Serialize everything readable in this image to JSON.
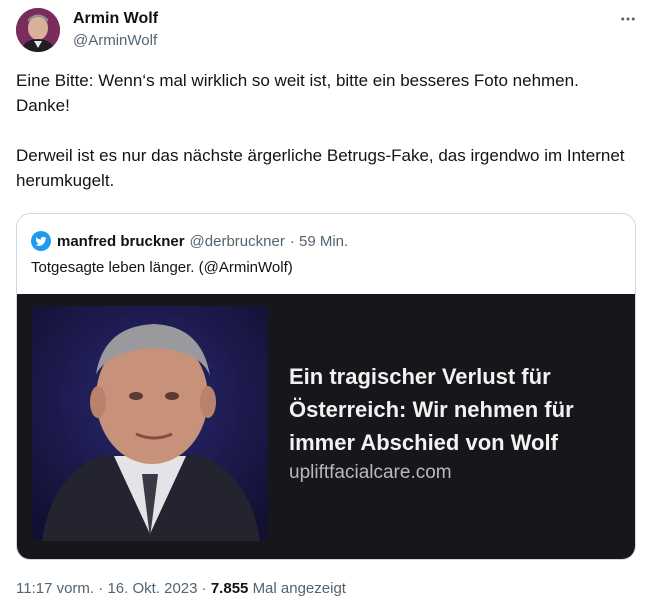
{
  "author": {
    "name": "Armin Wolf",
    "handle": "@ArminWolf",
    "avatar_icon": "profile-photo"
  },
  "more_icon": "more-horizontal-icon",
  "tweet": {
    "paragraph_1": "Eine Bitte: Wenn‘s mal wirklich so weit ist, bitte ein besseres Foto nehmen. Danke!",
    "paragraph_2": "Derweil ist es nur das nächste ärgerliche Betrugs-Fake, das irgendwo im Internet herumkugelt."
  },
  "quoted": {
    "icon": "twitter-bird-icon",
    "name": "manfred bruckner",
    "handle": "@derbruckner",
    "time": "· 59 Min.",
    "text": "Totgesagte leben länger. (@ArminWolf)",
    "card": {
      "title": "Ein tragischer Verlust für Österreich: Wir nehmen für immer Abschied von Wolf",
      "domain": "upliftfacialcare.com"
    }
  },
  "meta": {
    "time": "11:17 vorm.",
    "date": "16. Okt. 2023",
    "separator": "·",
    "views": "7.855",
    "views_label": "Mal angezeigt"
  },
  "colors": {
    "text": "#0f1419",
    "secondary": "#536471",
    "border": "#cfd9de",
    "twitter_blue": "#1d9bf0",
    "card_bg": "#17171b"
  }
}
